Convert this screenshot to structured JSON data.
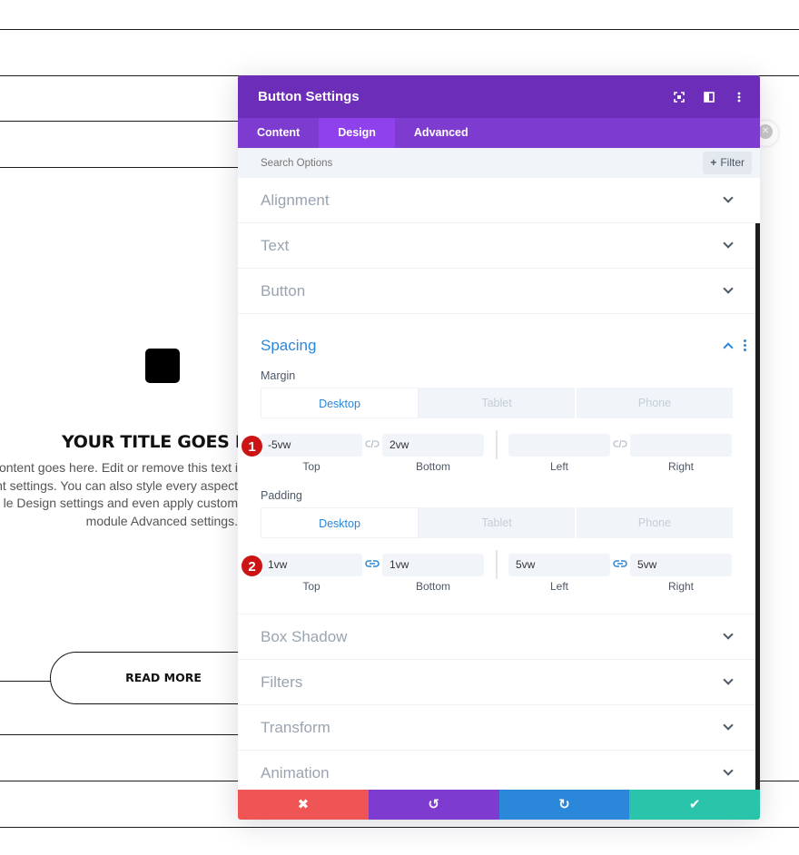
{
  "page": {
    "module_title": "YOUR TITLE GOES HE",
    "body_lines": [
      "ontent goes here. Edit or remove this text i",
      "nt settings. You can also style every aspect",
      "le Design settings and even apply custom",
      "module Advanced settings."
    ],
    "button_label": "READ MORE"
  },
  "panel": {
    "title": "Button Settings",
    "header_icons": [
      "focus-icon",
      "split-view-icon",
      "more-vertical-icon"
    ],
    "tabs": [
      {
        "label": "Content",
        "active": false
      },
      {
        "label": "Design",
        "active": true
      },
      {
        "label": "Advanced",
        "active": false
      }
    ],
    "search": {
      "placeholder": "Search Options",
      "filter_label": "Filter"
    },
    "sections_top": [
      "Alignment",
      "Text",
      "Button"
    ],
    "spacing": {
      "title": "Spacing",
      "margin": {
        "label": "Margin",
        "device_tabs": [
          "Desktop",
          "Tablet",
          "Phone"
        ],
        "top": "-5vw",
        "bottom": "2vw",
        "left": "",
        "right": "",
        "labels": [
          "Top",
          "Bottom",
          "Left",
          "Right"
        ],
        "badge": "1"
      },
      "padding": {
        "label": "Padding",
        "device_tabs": [
          "Desktop",
          "Tablet",
          "Phone"
        ],
        "top": "1vw",
        "bottom": "1vw",
        "left": "5vw",
        "right": "5vw",
        "labels": [
          "Top",
          "Bottom",
          "Left",
          "Right"
        ],
        "badge": "2"
      }
    },
    "sections_bottom": [
      "Box Shadow",
      "Filters",
      "Transform",
      "Animation"
    ],
    "footer": {
      "cancel_icon": "✖",
      "undo_icon": "↺",
      "redo_icon": "↻",
      "save_icon": "✔"
    }
  },
  "colors": {
    "header": "#6c2eb9",
    "tabs": "#7e3bd0",
    "active_tab": "#8f42ec",
    "accent": "#2b87da",
    "cancel": "#ef5555",
    "undo": "#7e3bd0",
    "redo": "#2b87da",
    "save": "#29c4a9",
    "badge": "#cc1414"
  }
}
